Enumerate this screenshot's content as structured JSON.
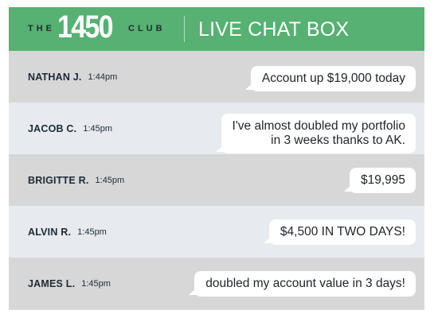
{
  "header": {
    "logo_the": "THE",
    "logo_number": "1450",
    "logo_club": "CLUB",
    "title": "LIVE CHAT BOX",
    "background": "#56b172"
  },
  "messages": [
    {
      "name": "NATHAN J.",
      "time": "1:44pm",
      "text": "Account up $19,000 today"
    },
    {
      "name": "JACOB C.",
      "time": "1:45pm",
      "text": "I've almost doubled my portfolio\nin 3 weeks thanks to AK."
    },
    {
      "name": "BRIGITTE R.",
      "time": "1:45pm",
      "text": "$19,995"
    },
    {
      "name": "ALVIN R.",
      "time": "1:45pm",
      "text": "$4,500 IN TWO DAYS!"
    },
    {
      "name": "JAMES L.",
      "time": "1:45pm",
      "text": "doubled my account value in 3 days!"
    }
  ]
}
